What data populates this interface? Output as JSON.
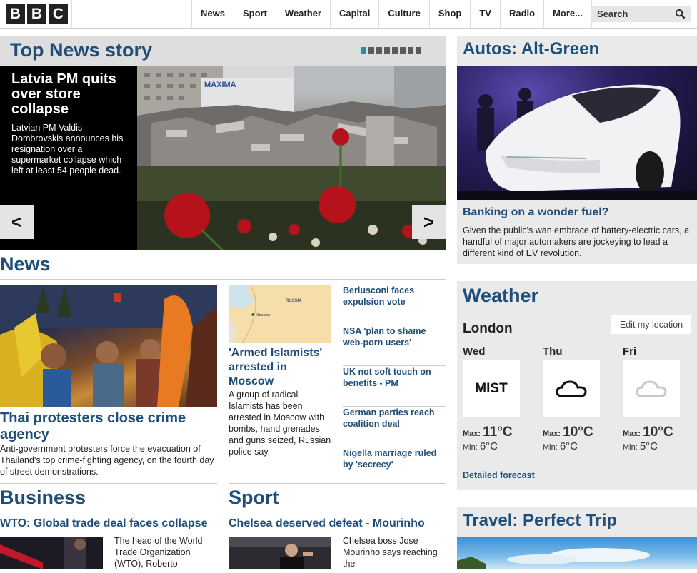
{
  "header": {
    "logo": [
      "B",
      "B",
      "C"
    ],
    "nav": [
      "News",
      "Sport",
      "Weather",
      "Capital",
      "Culture",
      "Shop",
      "TV",
      "Radio",
      "More..."
    ],
    "search_label": "Search"
  },
  "top_story": {
    "section_title": "Top News story",
    "headline": "Latvia PM quits over store collapse",
    "summary": "Latvian PM Valdis Dombrovskis announces his resignation over a supermarket collapse which left at least 54 people dead.",
    "carousel_pages": 8,
    "carousel_active": 1,
    "image_sign": "MAXIMA",
    "prev_label": "<",
    "next_label": ">"
  },
  "news": {
    "section_title": "News",
    "lead": {
      "headline": "Thai protesters close crime agency",
      "summary": "Anti-government protesters force the evacuation of Thailand's top crime-fighting agency, on the fourth day of street demonstrations."
    },
    "second": {
      "map_labels": [
        "RUSSIA",
        "Moscow"
      ],
      "headline": "'Armed Islamists' arrested in Moscow",
      "summary": "A group of radical Islamists has been arrested in Moscow with bombs, hand grenades and guns seized, Russian police say."
    },
    "list": [
      "Berlusconi faces expulsion vote",
      "NSA 'plan to shame web-porn users'",
      "UK not soft touch on benefits - PM",
      "German parties reach coalition deal",
      "Nigella marriage ruled by 'secrecy'"
    ]
  },
  "business": {
    "section_title": "Business",
    "headline": "WTO: Global trade deal faces collapse",
    "summary": "The head of the World Trade Organization (WTO), Roberto"
  },
  "sport": {
    "section_title": "Sport",
    "headline": "Chelsea deserved defeat - Mourinho",
    "summary": "Chelsea boss Jose Mourinho says reaching the"
  },
  "autos": {
    "section_title": "Autos: Alt-Green",
    "headline": "Banking on a wonder fuel?",
    "summary": "Given the public's wan embrace of battery-electric cars, a handful of major automakers are jockeying to lead a different kind of EV revolution."
  },
  "weather": {
    "section_title": "Weather",
    "city": "London",
    "edit_label": "Edit my location",
    "days": [
      {
        "name": "Wed",
        "icon": "mist-text",
        "icon_text": "MIST",
        "max_label": "Max:",
        "max": "11°C",
        "min_label": "Min:",
        "min": "6°C"
      },
      {
        "name": "Thu",
        "icon": "cloud-icon",
        "icon_text": "",
        "max_label": "Max:",
        "max": "10°C",
        "min_label": "Min:",
        "min": "6°C"
      },
      {
        "name": "Fri",
        "icon": "cloud-light-icon",
        "icon_text": "",
        "max_label": "Max:",
        "max": "10°C",
        "min_label": "Min:",
        "min": "5°C"
      }
    ],
    "forecast_link": "Detailed forecast"
  },
  "travel": {
    "section_title": "Travel: Perfect Trip"
  },
  "colors": {
    "accent_blue": "#1f4e79",
    "panel_grey": "#eaeaea",
    "carousel_active": "#2d8ba8"
  }
}
